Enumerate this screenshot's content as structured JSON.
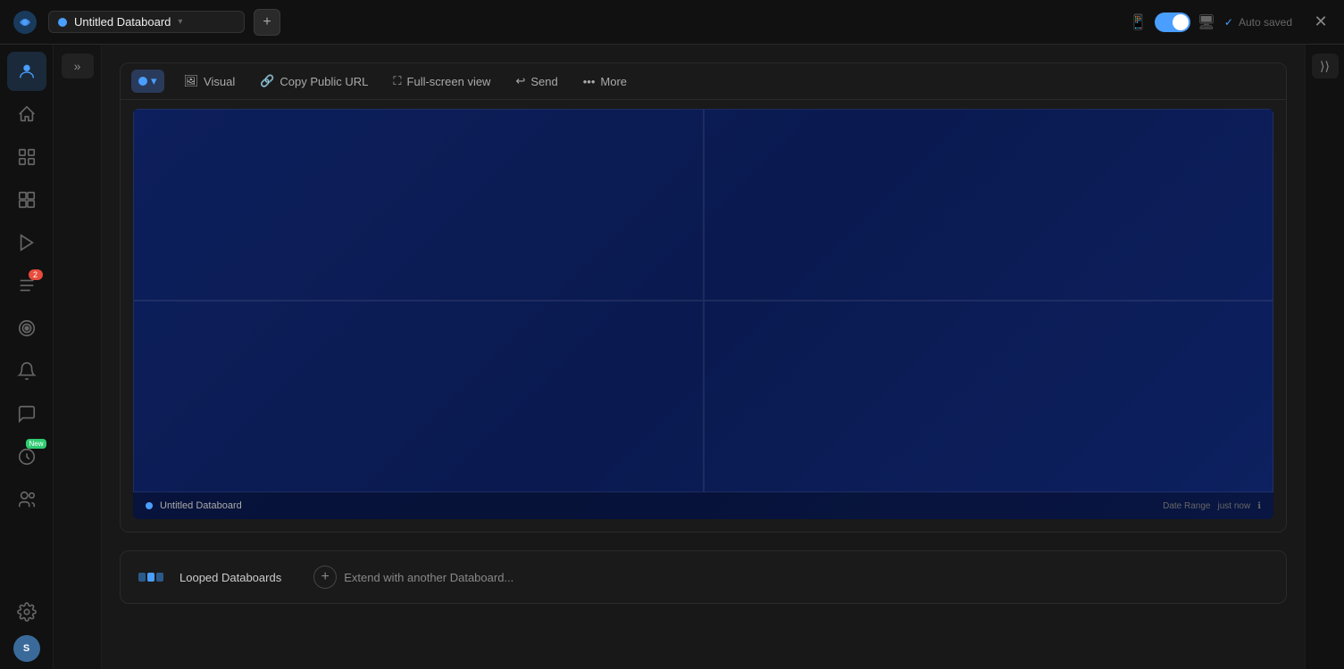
{
  "header": {
    "title": "Untitled Databoard",
    "add_btn_label": "+",
    "auto_saved": "Auto saved",
    "close_icon": "✕"
  },
  "sidebar": {
    "items": [
      {
        "id": "people",
        "icon": "👤",
        "active": true
      },
      {
        "id": "home",
        "icon": "⌂"
      },
      {
        "id": "numbers",
        "icon": "🔢"
      },
      {
        "id": "dashboard",
        "icon": "▦"
      },
      {
        "id": "video",
        "icon": "▶"
      },
      {
        "id": "tasks",
        "icon": "≡",
        "badge": "2"
      },
      {
        "id": "goals",
        "icon": "◎"
      },
      {
        "id": "alerts",
        "icon": "🔔"
      },
      {
        "id": "chat",
        "icon": "💬"
      },
      {
        "id": "new-feature",
        "icon": "⚡",
        "new_badge": "New"
      },
      {
        "id": "team",
        "icon": "👥"
      }
    ],
    "bottom": [
      {
        "id": "settings",
        "icon": "⚙"
      }
    ],
    "avatar_text": "S"
  },
  "collapse": {
    "icon": "»"
  },
  "toolbar": {
    "dropdown_color": "#4a9eff",
    "items": [
      {
        "id": "visual",
        "icon": "🖼",
        "label": "Visual"
      },
      {
        "id": "copy-url",
        "icon": "🔗",
        "label": "Copy Public URL"
      },
      {
        "id": "fullscreen",
        "icon": "⛶",
        "label": "Full-screen view"
      },
      {
        "id": "send",
        "icon": "↩",
        "label": "Send"
      },
      {
        "id": "more",
        "icon": "•••",
        "label": "More"
      }
    ]
  },
  "preview": {
    "title": "Untitled Databoard",
    "date_range": "Date Range",
    "timestamp": "just now"
  },
  "looped": {
    "label": "Looped Databoards"
  },
  "extend": {
    "label": "Extend with another Databoard..."
  }
}
